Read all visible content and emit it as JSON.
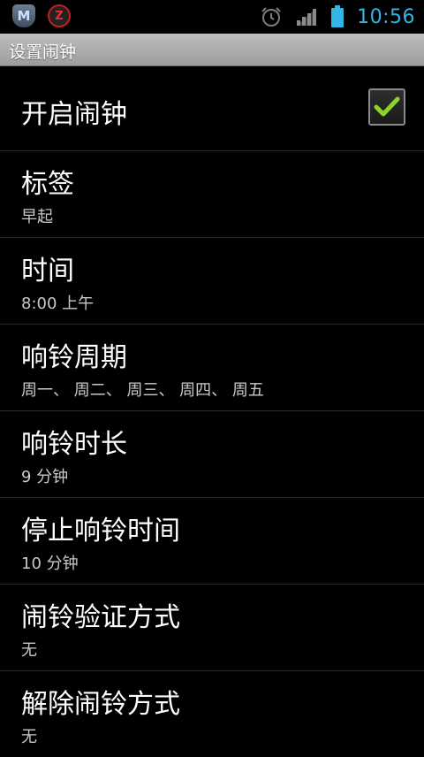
{
  "status_bar": {
    "time": "10:56",
    "time_color": "#33b5e5",
    "left_icons": [
      {
        "name": "m-app-icon",
        "glyph": "M"
      },
      {
        "name": "z-app-icon",
        "glyph": "Z"
      }
    ],
    "right_icons": [
      "alarm-clock-icon",
      "signal-icon",
      "battery-icon"
    ]
  },
  "header": {
    "title": "设置闹钟"
  },
  "settings": {
    "enable_alarm": {
      "title": "开启闹钟",
      "checked": true
    },
    "items": [
      {
        "title": "标签",
        "summary": "早起"
      },
      {
        "title": "时间",
        "summary": "8:00 上午"
      },
      {
        "title": "响铃周期",
        "summary": "周一、 周二、 周三、 周四、 周五"
      },
      {
        "title": "响铃时长",
        "summary": "9 分钟"
      },
      {
        "title": "停止响铃时间",
        "summary": "10 分钟"
      },
      {
        "title": "闹铃验证方式",
        "summary": "无"
      },
      {
        "title": "解除闹铃方式",
        "summary": "无"
      }
    ]
  },
  "colors": {
    "accent": "#33b5e5",
    "check_green": "#8bd32c",
    "background": "#000000"
  }
}
